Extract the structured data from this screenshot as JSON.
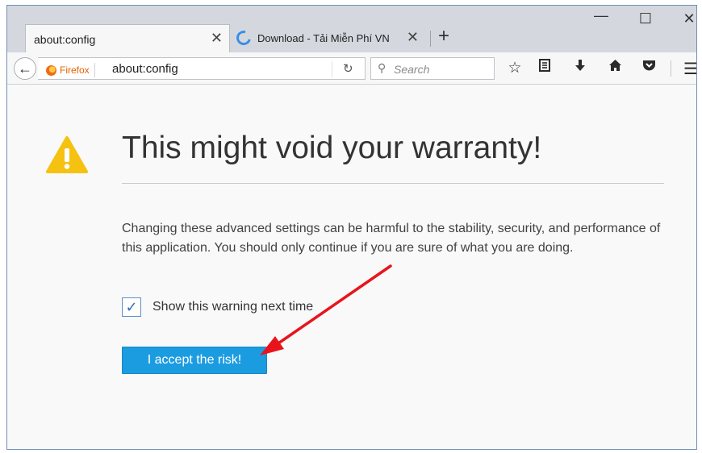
{
  "browser": {
    "active_tab": {
      "title": "about:config",
      "close_glyph": "✕"
    },
    "inactive_tab": {
      "title": "Download - Tải Miễn Phí VN",
      "close_glyph": "✕",
      "status": "loading"
    },
    "new_tab_glyph": "+",
    "window_controls": {
      "minimize": "—",
      "maximize": "☐",
      "close": "✕"
    }
  },
  "navbar": {
    "back_glyph": "←",
    "identity_label": "Firefox",
    "url": "about:config",
    "reload_glyph": "↻",
    "search_placeholder": "Search",
    "icons": [
      "star-icon",
      "reader-icon",
      "download-icon",
      "home-icon",
      "pocket-icon",
      "menu-icon"
    ]
  },
  "page": {
    "title": "This might void your warranty!",
    "description": "Changing these advanced settings can be harmful to the stability, security, and performance of this application. You should only continue if you are sure of what you are doing.",
    "checkbox_label": "Show this warning next time",
    "checkbox_checked": true,
    "checkbox_glyph": "✓",
    "accept_button": "I accept the risk!"
  },
  "colors": {
    "accent_button": "#1c9ce0",
    "warning_icon": "#f5c211",
    "annotation_arrow": "#e8141c"
  }
}
